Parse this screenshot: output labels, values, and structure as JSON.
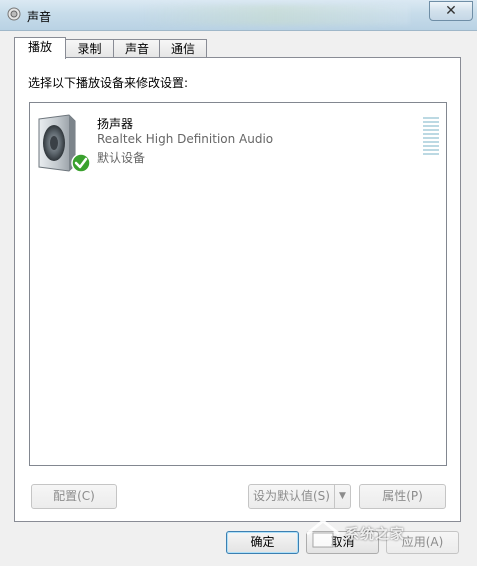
{
  "window": {
    "title": "声音",
    "close_label": "✕"
  },
  "tabs": [
    {
      "label": "播放",
      "active": true
    },
    {
      "label": "录制",
      "active": false
    },
    {
      "label": "声音",
      "active": false
    },
    {
      "label": "通信",
      "active": false
    }
  ],
  "playback": {
    "instruction": "选择以下播放设备来修改设置:",
    "devices": [
      {
        "name": "扬声器",
        "driver": "Realtek High Definition Audio",
        "status": "默认设备",
        "icon": "speaker-icon",
        "badge": "check-icon"
      }
    ]
  },
  "buttons": {
    "configure": "配置(C)",
    "set_default": "设为默认值(S)",
    "properties": "属性(P)",
    "ok": "确定",
    "cancel": "取消",
    "apply": "应用(A)"
  },
  "watermark": {
    "text": "系统之家"
  },
  "colors": {
    "check_green": "#3aa12e",
    "titlebar": "#c7dcea",
    "level_meter": "#bcd9e3"
  }
}
